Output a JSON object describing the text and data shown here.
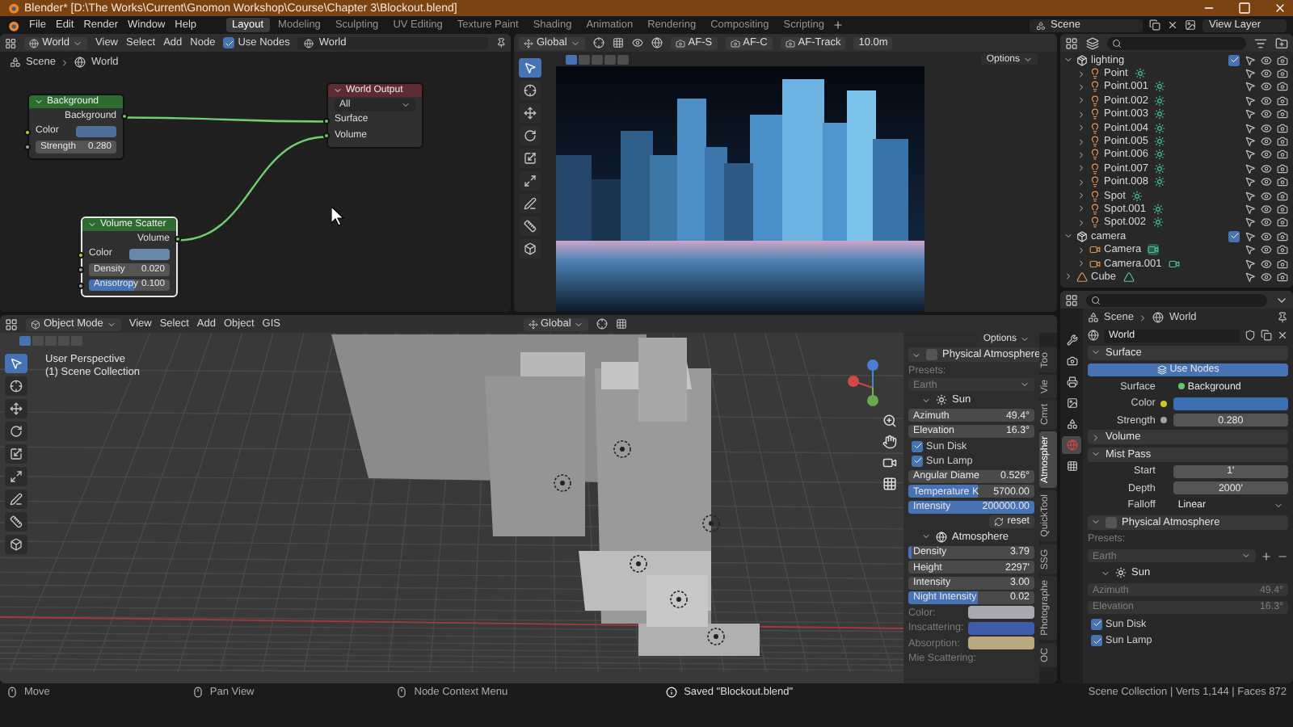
{
  "window": {
    "title": "Blender* [D:\\The Works\\Current\\Gnomon Workshop\\Course\\Chapter 3\\Blockout.blend]"
  },
  "menu": [
    "File",
    "Edit",
    "Render",
    "Window",
    "Help"
  ],
  "workspaces": [
    {
      "label": "Layout",
      "selected": true
    },
    {
      "label": "Modeling",
      "selected": false
    },
    {
      "label": "Sculpting",
      "selected": false
    },
    {
      "label": "UV Editing",
      "selected": false
    },
    {
      "label": "Texture Paint",
      "selected": false
    },
    {
      "label": "Shading",
      "selected": false
    },
    {
      "label": "Animation",
      "selected": false
    },
    {
      "label": "Rendering",
      "selected": false
    },
    {
      "label": "Compositing",
      "selected": false
    },
    {
      "label": "Scripting",
      "selected": false
    }
  ],
  "scene": "Scene",
  "view_layer": "View Layer",
  "node_editor": {
    "header": {
      "type": "World",
      "menus": [
        "View",
        "Select",
        "Add",
        "Node"
      ],
      "use_nodes": {
        "label": "Use Nodes",
        "checked": true
      },
      "world": "World"
    },
    "breadcrumb": [
      "Scene",
      "World"
    ],
    "nodes": [
      {
        "title": "Background",
        "kind": "shader",
        "selected": false,
        "rows": [
          {
            "kind": "output",
            "label": "Background"
          },
          {
            "kind": "color",
            "label": "Color",
            "color": "#4d6f99"
          },
          {
            "kind": "value",
            "label": "Strength",
            "value": "0.280"
          }
        ]
      },
      {
        "title": "World Output",
        "kind": "output",
        "selected": false,
        "rows": [
          {
            "kind": "dropdown",
            "value": "All"
          },
          {
            "kind": "input",
            "label": "Surface"
          },
          {
            "kind": "input",
            "label": "Volume"
          }
        ]
      },
      {
        "title": "Volume Scatter",
        "kind": "shader",
        "selected": true,
        "rows": [
          {
            "kind": "output",
            "label": "Volume"
          },
          {
            "kind": "color",
            "label": "Color",
            "color": "#6a88a8"
          },
          {
            "kind": "value",
            "label": "Density",
            "value": "0.020"
          },
          {
            "kind": "value",
            "label": "Anisotropy",
            "value": "0.100",
            "level": 0.55
          }
        ]
      }
    ]
  },
  "camera_view": {
    "orientation": "Global",
    "af": [
      "AF-S",
      "AF-C",
      "AF-Track"
    ],
    "distance": "10.0m",
    "options": "Options",
    "tools": [
      {
        "kind": "select",
        "selected": true
      },
      {
        "kind": "cursor",
        "selected": false
      },
      {
        "kind": "move",
        "selected": false
      },
      {
        "kind": "rotate",
        "selected": false
      },
      {
        "kind": "scale",
        "selected": false
      },
      {
        "kind": "transform",
        "selected": false
      },
      {
        "kind": "annotate",
        "selected": false
      },
      {
        "kind": "measure",
        "selected": false
      },
      {
        "kind": "addcube",
        "selected": false
      }
    ]
  },
  "viewport": {
    "mode": "Object Mode",
    "menus": [
      "View",
      "Select",
      "Add",
      "Object",
      "GIS"
    ],
    "orientation": "Global",
    "options": "Options",
    "info": [
      "User Perspective",
      "(1) Scene Collection"
    ],
    "tools": [
      {
        "kind": "select",
        "selected": true
      },
      {
        "kind": "cursor",
        "selected": false
      },
      {
        "kind": "move",
        "selected": false
      },
      {
        "kind": "rotate",
        "selected": false
      },
      {
        "kind": "scale",
        "selected": false
      },
      {
        "kind": "transform",
        "selected": false
      },
      {
        "kind": "annotate",
        "selected": false
      },
      {
        "kind": "measure",
        "selected": false
      },
      {
        "kind": "addcube",
        "selected": false
      }
    ],
    "sidebar_tabs": [
      {
        "label": "Too",
        "selected": false
      },
      {
        "label": "Vie",
        "selected": false
      },
      {
        "label": "Cmrt",
        "selected": false
      },
      {
        "label": "Atmospher",
        "selected": true
      },
      {
        "label": "QuickTool",
        "selected": false
      },
      {
        "label": "SSG",
        "selected": false
      },
      {
        "label": "Photographe",
        "selected": false
      },
      {
        "label": "OC",
        "selected": false
      }
    ],
    "sidebar_rows": [
      {
        "kind": "panel",
        "label": "Physical Atmosphere",
        "expanded": true,
        "checked": false
      },
      {
        "kind": "label",
        "label": "Presets:"
      },
      {
        "kind": "dropdown",
        "value": "Earth",
        "disabled": true
      },
      {
        "kind": "sunpanel",
        "label": "Sun",
        "expanded": true
      },
      {
        "kind": "slider",
        "label": "Azimuth",
        "value": "49.4°"
      },
      {
        "kind": "slider",
        "label": "Elevation",
        "value": "16.3°"
      },
      {
        "kind": "check",
        "label": "Sun Disk",
        "checked": true
      },
      {
        "kind": "check",
        "label": "Sun Lamp",
        "checked": true
      },
      {
        "kind": "slider",
        "label": "Angular Diame",
        "value": "0.526°"
      },
      {
        "kind": "slider",
        "label": "Temperature K",
        "value": "5700.00",
        "level": 0.55
      },
      {
        "kind": "slider",
        "label": "Intensity",
        "value": "200000.00",
        "level": 1
      },
      {
        "kind": "button",
        "label": "reset",
        "on": false
      },
      {
        "kind": "atmospanel",
        "label": "Atmosphere",
        "expanded": true
      },
      {
        "kind": "slider",
        "label": "Density",
        "value": "3.79",
        "level": 0.03
      },
      {
        "kind": "slider",
        "label": "Height",
        "value": "2297'"
      },
      {
        "kind": "slider",
        "label": "Intensity",
        "value": "3.00"
      },
      {
        "kind": "slider",
        "label": "Night Intensity",
        "value": "0.02",
        "level": 0.55
      },
      {
        "kind": "swatch",
        "label": "Color:",
        "color": "#a9a9b1"
      },
      {
        "kind": "swatch",
        "label": "Inscattering:",
        "color": "#3e5ca8"
      },
      {
        "kind": "swatch",
        "label": "Absorption:",
        "color": "#b9a983"
      },
      {
        "kind": "label",
        "label": "Mie Scattering:"
      }
    ]
  },
  "outliner": {
    "items": [
      {
        "kind": "collection",
        "label": "lighting",
        "expanded": true,
        "checked": true,
        "children": [
          {
            "kind": "point",
            "label": "Point",
            "expanded": false
          },
          {
            "kind": "point",
            "label": "Point.001",
            "expanded": false
          },
          {
            "kind": "point",
            "label": "Point.002",
            "expanded": false
          },
          {
            "kind": "point",
            "label": "Point.003",
            "expanded": false
          },
          {
            "kind": "point",
            "label": "Point.004",
            "expanded": false
          },
          {
            "kind": "point",
            "label": "Point.005",
            "expanded": false
          },
          {
            "kind": "point",
            "label": "Point.006",
            "expanded": false
          },
          {
            "kind": "point",
            "label": "Point.007",
            "expanded": false
          },
          {
            "kind": "point",
            "label": "Point.008",
            "expanded": false
          },
          {
            "kind": "spot",
            "label": "Spot",
            "expanded": false
          },
          {
            "kind": "spot",
            "label": "Spot.001",
            "expanded": false
          },
          {
            "kind": "spot",
            "label": "Spot.002",
            "expanded": false
          }
        ]
      },
      {
        "kind": "collection",
        "label": "camera",
        "expanded": true,
        "checked": true,
        "children": [
          {
            "kind": "camera",
            "label": "Camera",
            "expanded": false,
            "active": true
          },
          {
            "kind": "camera",
            "label": "Camera.001",
            "expanded": false,
            "active": false
          }
        ]
      },
      {
        "kind": "mesh",
        "label": "Cube",
        "expanded": false
      }
    ]
  },
  "properties": {
    "tabs": [
      {
        "kind": "tool",
        "selected": false
      },
      {
        "kind": "render",
        "selected": false
      },
      {
        "kind": "output",
        "selected": false
      },
      {
        "kind": "viewlayer",
        "selected": false
      },
      {
        "kind": "scene",
        "selected": false
      },
      {
        "kind": "world",
        "selected": true
      },
      {
        "kind": "texture",
        "selected": false
      }
    ],
    "breadcrumb": [
      "Scene",
      "World"
    ],
    "world": "World",
    "rows": [
      {
        "kind": "panel",
        "label": "Surface",
        "expanded": true
      },
      {
        "kind": "button",
        "label": "Use Nodes",
        "on": true
      },
      {
        "kind": "link",
        "label": "Surface",
        "value": "Background"
      },
      {
        "kind": "swatch",
        "label": "Color",
        "color": "#3c6eb4",
        "socket": true
      },
      {
        "kind": "field",
        "label": "Strength",
        "value": "0.280",
        "socket": true
      },
      {
        "kind": "panel",
        "label": "Volume",
        "expanded": false
      },
      {
        "kind": "panel",
        "label": "Mist Pass",
        "expanded": true
      },
      {
        "kind": "field",
        "label": "Start",
        "value": "1'"
      },
      {
        "kind": "field",
        "label": "Depth",
        "value": "2000'"
      },
      {
        "kind": "dropdown",
        "label": "Falloff",
        "value": "Linear"
      },
      {
        "kind": "panel",
        "label": "Physical Atmosphere",
        "expanded": true,
        "checked": false
      },
      {
        "kind": "label",
        "label": "Presets:"
      },
      {
        "kind": "dropdown",
        "value": "Earth",
        "disabled": true
      },
      {
        "kind": "sunpanel",
        "label": "Sun",
        "expanded": true
      },
      {
        "kind": "slider",
        "label": "Azimuth",
        "value": "49.4°",
        "disabled": true
      },
      {
        "kind": "slider",
        "label": "Elevation",
        "value": "16.3°",
        "disabled": true
      },
      {
        "kind": "check",
        "label": "Sun Disk",
        "checked": true
      },
      {
        "kind": "check",
        "label": "Sun Lamp",
        "checked": true
      }
    ]
  },
  "status_bar": {
    "hints": [
      "Move",
      "Pan View",
      "Node Context Menu"
    ],
    "message": "Saved \"Blockout.blend\"",
    "stats": "Scene Collection | Verts 1,144 | Faces 872"
  }
}
